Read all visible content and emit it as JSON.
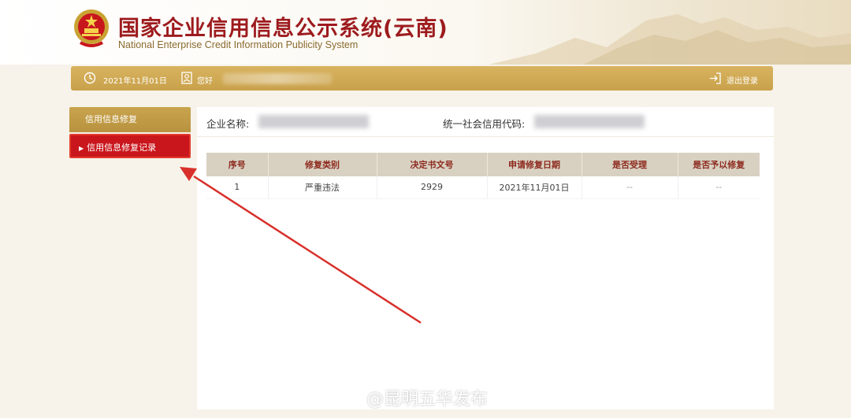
{
  "header": {
    "title_cn": "国家企业信用信息公示系统(云南)",
    "title_en": "National Enterprise Credit Information Publicity System"
  },
  "topbar": {
    "date": "2021年11月01日",
    "greeting": "您好",
    "logout_label": "退出登录"
  },
  "sidebar": {
    "section_title": "信用信息修复",
    "items": [
      {
        "label": "信用信息修复记录",
        "active": true
      }
    ]
  },
  "main": {
    "company_name_label": "企业名称:",
    "credit_code_label": "统一社会信用代码:",
    "table": {
      "columns": [
        "序号",
        "修复类别",
        "决定书文号",
        "申请修复日期",
        "是否受理",
        "是否予以修复"
      ],
      "rows": [
        [
          "1",
          "严重违法",
          "2929",
          "2021年11月01日",
          "--",
          "--"
        ]
      ]
    }
  },
  "watermark": {
    "text": "@昆明五华发布"
  },
  "colors": {
    "brand_red": "#9d1b1e",
    "gold_bar": "#c9a14b",
    "active_red": "#c9161c",
    "arrow_red": "#d8302a"
  }
}
